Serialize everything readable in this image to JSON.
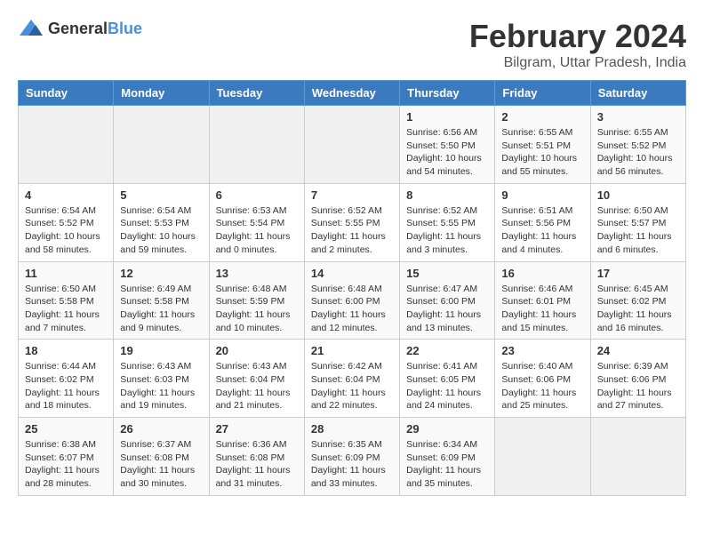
{
  "header": {
    "logo_general": "General",
    "logo_blue": "Blue",
    "title": "February 2024",
    "subtitle": "Bilgram, Uttar Pradesh, India"
  },
  "days_of_week": [
    "Sunday",
    "Monday",
    "Tuesday",
    "Wednesday",
    "Thursday",
    "Friday",
    "Saturday"
  ],
  "weeks": [
    [
      {
        "day": "",
        "info": ""
      },
      {
        "day": "",
        "info": ""
      },
      {
        "day": "",
        "info": ""
      },
      {
        "day": "",
        "info": ""
      },
      {
        "day": "1",
        "info": "Sunrise: 6:56 AM\nSunset: 5:50 PM\nDaylight: 10 hours\nand 54 minutes."
      },
      {
        "day": "2",
        "info": "Sunrise: 6:55 AM\nSunset: 5:51 PM\nDaylight: 10 hours\nand 55 minutes."
      },
      {
        "day": "3",
        "info": "Sunrise: 6:55 AM\nSunset: 5:52 PM\nDaylight: 10 hours\nand 56 minutes."
      }
    ],
    [
      {
        "day": "4",
        "info": "Sunrise: 6:54 AM\nSunset: 5:52 PM\nDaylight: 10 hours\nand 58 minutes."
      },
      {
        "day": "5",
        "info": "Sunrise: 6:54 AM\nSunset: 5:53 PM\nDaylight: 10 hours\nand 59 minutes."
      },
      {
        "day": "6",
        "info": "Sunrise: 6:53 AM\nSunset: 5:54 PM\nDaylight: 11 hours\nand 0 minutes."
      },
      {
        "day": "7",
        "info": "Sunrise: 6:52 AM\nSunset: 5:55 PM\nDaylight: 11 hours\nand 2 minutes."
      },
      {
        "day": "8",
        "info": "Sunrise: 6:52 AM\nSunset: 5:55 PM\nDaylight: 11 hours\nand 3 minutes."
      },
      {
        "day": "9",
        "info": "Sunrise: 6:51 AM\nSunset: 5:56 PM\nDaylight: 11 hours\nand 4 minutes."
      },
      {
        "day": "10",
        "info": "Sunrise: 6:50 AM\nSunset: 5:57 PM\nDaylight: 11 hours\nand 6 minutes."
      }
    ],
    [
      {
        "day": "11",
        "info": "Sunrise: 6:50 AM\nSunset: 5:58 PM\nDaylight: 11 hours\nand 7 minutes."
      },
      {
        "day": "12",
        "info": "Sunrise: 6:49 AM\nSunset: 5:58 PM\nDaylight: 11 hours\nand 9 minutes."
      },
      {
        "day": "13",
        "info": "Sunrise: 6:48 AM\nSunset: 5:59 PM\nDaylight: 11 hours\nand 10 minutes."
      },
      {
        "day": "14",
        "info": "Sunrise: 6:48 AM\nSunset: 6:00 PM\nDaylight: 11 hours\nand 12 minutes."
      },
      {
        "day": "15",
        "info": "Sunrise: 6:47 AM\nSunset: 6:00 PM\nDaylight: 11 hours\nand 13 minutes."
      },
      {
        "day": "16",
        "info": "Sunrise: 6:46 AM\nSunset: 6:01 PM\nDaylight: 11 hours\nand 15 minutes."
      },
      {
        "day": "17",
        "info": "Sunrise: 6:45 AM\nSunset: 6:02 PM\nDaylight: 11 hours\nand 16 minutes."
      }
    ],
    [
      {
        "day": "18",
        "info": "Sunrise: 6:44 AM\nSunset: 6:02 PM\nDaylight: 11 hours\nand 18 minutes."
      },
      {
        "day": "19",
        "info": "Sunrise: 6:43 AM\nSunset: 6:03 PM\nDaylight: 11 hours\nand 19 minutes."
      },
      {
        "day": "20",
        "info": "Sunrise: 6:43 AM\nSunset: 6:04 PM\nDaylight: 11 hours\nand 21 minutes."
      },
      {
        "day": "21",
        "info": "Sunrise: 6:42 AM\nSunset: 6:04 PM\nDaylight: 11 hours\nand 22 minutes."
      },
      {
        "day": "22",
        "info": "Sunrise: 6:41 AM\nSunset: 6:05 PM\nDaylight: 11 hours\nand 24 minutes."
      },
      {
        "day": "23",
        "info": "Sunrise: 6:40 AM\nSunset: 6:06 PM\nDaylight: 11 hours\nand 25 minutes."
      },
      {
        "day": "24",
        "info": "Sunrise: 6:39 AM\nSunset: 6:06 PM\nDaylight: 11 hours\nand 27 minutes."
      }
    ],
    [
      {
        "day": "25",
        "info": "Sunrise: 6:38 AM\nSunset: 6:07 PM\nDaylight: 11 hours\nand 28 minutes."
      },
      {
        "day": "26",
        "info": "Sunrise: 6:37 AM\nSunset: 6:08 PM\nDaylight: 11 hours\nand 30 minutes."
      },
      {
        "day": "27",
        "info": "Sunrise: 6:36 AM\nSunset: 6:08 PM\nDaylight: 11 hours\nand 31 minutes."
      },
      {
        "day": "28",
        "info": "Sunrise: 6:35 AM\nSunset: 6:09 PM\nDaylight: 11 hours\nand 33 minutes."
      },
      {
        "day": "29",
        "info": "Sunrise: 6:34 AM\nSunset: 6:09 PM\nDaylight: 11 hours\nand 35 minutes."
      },
      {
        "day": "",
        "info": ""
      },
      {
        "day": "",
        "info": ""
      }
    ]
  ]
}
